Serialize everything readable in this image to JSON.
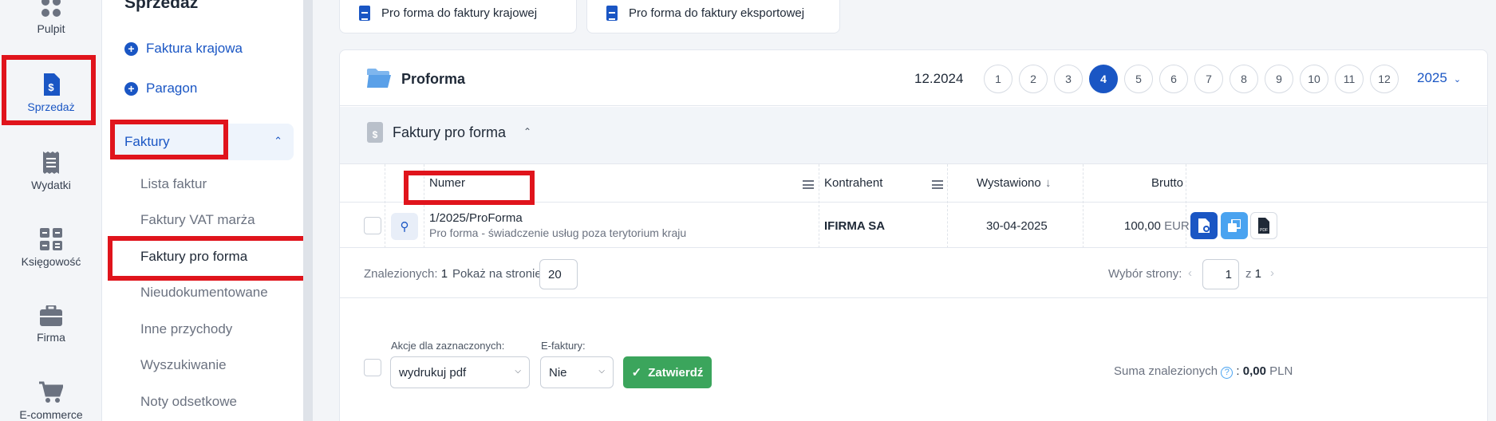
{
  "rail": {
    "items": [
      {
        "label": "Pulpit",
        "icon": "dashboard-icon"
      },
      {
        "label": "Sprzedaż",
        "icon": "invoice-dollar-icon"
      },
      {
        "label": "Wydatki",
        "icon": "receipt-icon"
      },
      {
        "label": "Księgowość",
        "icon": "calculator-icon"
      },
      {
        "label": "Firma",
        "icon": "briefcase-icon"
      },
      {
        "label": "E-commerce",
        "icon": "cart-icon"
      }
    ]
  },
  "subnav": {
    "title": "Sprzedaż",
    "add_invoice": "Faktura krajowa",
    "add_receipt": "Paragon",
    "group_label": "Faktury",
    "links": [
      "Lista faktur",
      "Faktury VAT marża",
      "Faktury pro forma",
      "Nieudokumentowane",
      "Inne przychody",
      "Wyszukiwanie",
      "Noty odsetkowe"
    ]
  },
  "top_buttons": {
    "domestic": "Pro forma do faktury krajowej",
    "export": "Pro forma do faktury eksportowej"
  },
  "panel": {
    "title": "Proforma",
    "period": "12.2024",
    "months": [
      "1",
      "2",
      "3",
      "4",
      "5",
      "6",
      "7",
      "8",
      "9",
      "10",
      "11",
      "12"
    ],
    "active_month": "4",
    "year": "2025"
  },
  "section": {
    "title": "Faktury pro forma",
    "icon_glyph": "$"
  },
  "table": {
    "headers": {
      "number": "Numer",
      "contractor": "Kontrahent",
      "issued": "Wystawiono",
      "gross": "Brutto"
    },
    "rows": [
      {
        "number": "1/2025/ProForma",
        "description": "Pro forma - świadczenie usług poza terytorium kraju",
        "contractor": "IFIRMA SA",
        "issued": "30-04-2025",
        "gross": "100,00",
        "currency": "EUR"
      }
    ]
  },
  "pager": {
    "found_label": "Znalezionych:",
    "found_count": "1",
    "per_page_label": "Pokaż na stronie:",
    "per_page_value": "20",
    "page_select_label": "Wybór strony:",
    "page_value": "1",
    "of_label": "z",
    "total_pages": "1"
  },
  "bulk": {
    "actions_label": "Akcje dla zaznaczonych:",
    "actions_value": "wydrukuj pdf",
    "einvoice_label": "E-faktury:",
    "einvoice_value": "Nie",
    "confirm_label": "Zatwierdź",
    "sum_label": "Suma znalezionych",
    "sum_value": "0,00",
    "sum_currency": "PLN"
  },
  "colors": {
    "accent": "#1a56c4",
    "highlight": "#e0141c",
    "confirm": "#3ba55c",
    "copy_button": "#4aa3f0"
  }
}
